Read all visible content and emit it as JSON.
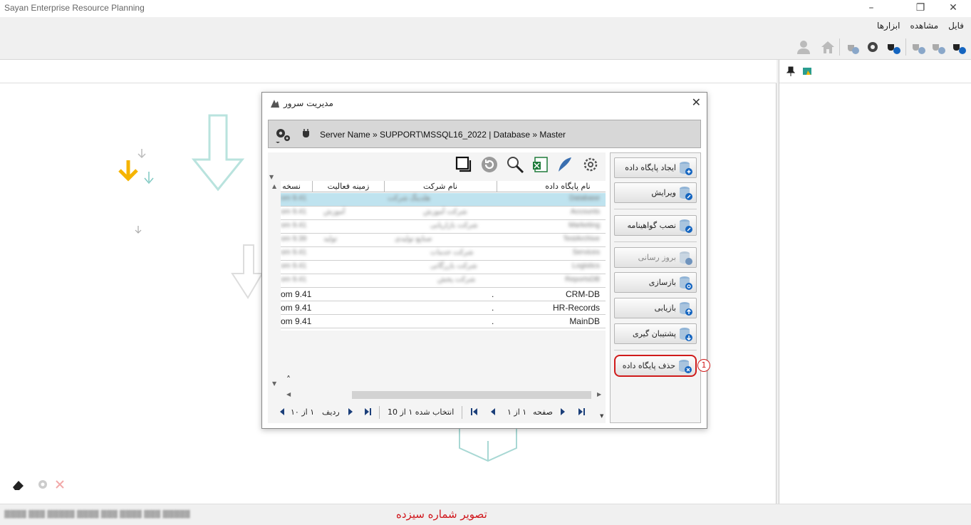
{
  "window": {
    "title": "Sayan Enterprise Resource Planning"
  },
  "menu": {
    "items": [
      "فایل",
      "مشاهده",
      "ابزارها"
    ]
  },
  "dialog": {
    "title": "مدیریت سرور",
    "path": "Server Name » SUPPORT\\MSSQL16_2022 | Database » Master",
    "actions": {
      "create": "ایجاد پایگاه داده",
      "edit": "ویرایش",
      "certificate": "نصب گواهینامه",
      "update": "بروز رسانی",
      "rebuild": "بازسازی",
      "restore": "بازیابی",
      "backup": "پشتیبان گیری",
      "delete": "حذف پایگاه داده",
      "callout": "1"
    },
    "table": {
      "columns": [
        "نام پایگاه داده",
        "نام شرکت",
        "زمینه فعالیت",
        "نسخه"
      ],
      "visible_rows": [
        {
          "db": "CRM-DB",
          "company": ".",
          "activity": "",
          "version": "om 9.41"
        },
        {
          "db": "HR-Records",
          "company": ".",
          "activity": "",
          "version": "om 9.41"
        },
        {
          "db": "MainDB",
          "company": ".",
          "activity": "",
          "version": "om 9.41"
        }
      ]
    },
    "pager": {
      "row_label": "ردیف",
      "row_text": "١ از ١٠",
      "selected": "انتخاب شده ١ از 10",
      "page_label": "صفحه",
      "page_text": "١ از ١"
    }
  },
  "status": {
    "caption": "تصویر شماره سیزده"
  },
  "colors": {
    "accent_red": "#d01b1b",
    "selection": "#bfe3ef",
    "arrow_yellow": "#f5b400"
  },
  "icons": [
    "user-icon",
    "home-icon",
    "plug-download-icon",
    "gear-icon",
    "plug-info-icon",
    "plug-check-icon",
    "plug-remove-icon",
    "plug-add-icon",
    "pin-icon",
    "database-icon"
  ]
}
